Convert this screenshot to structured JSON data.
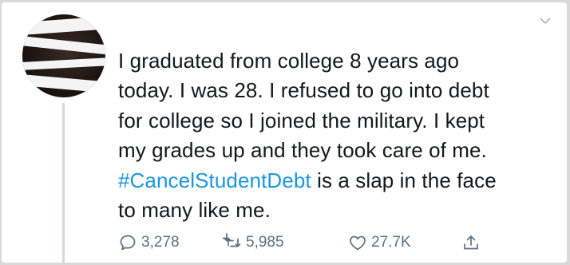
{
  "tweet": {
    "text_lines": [
      "I graduated from college 8 years ago",
      "today. I was 28. I refused to go into debt",
      "for college so I joined the military. I kept",
      "my grades up and they took care of me."
    ],
    "hashtag": "#CancelStudentDebt",
    "line5_rest": " is a slap in the face",
    "line6": "to many like me."
  },
  "actions": {
    "replies": "3,278",
    "retweets": "5,985",
    "likes": "27.7K"
  },
  "icons": {
    "reply": "reply-icon",
    "retweet": "retweet-icon",
    "like": "heart-icon",
    "share": "share-icon",
    "more": "chevron-down-icon"
  },
  "colors": {
    "hashtag": "#1b95e0",
    "text": "#14171a",
    "action": "#5b7083"
  }
}
